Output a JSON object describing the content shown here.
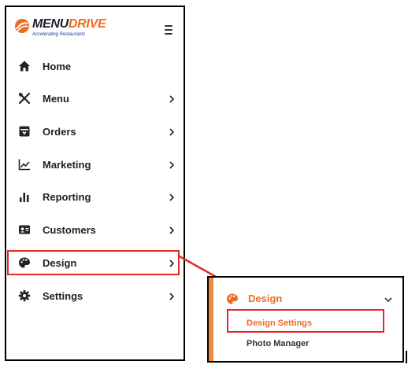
{
  "brand": {
    "name_part1": "MENU",
    "name_part2": "DRIVE",
    "tagline": "Accelerating Restaurants"
  },
  "sidebar": {
    "items": [
      {
        "label": "Home",
        "icon": "home-icon",
        "has_chevron": false
      },
      {
        "label": "Menu",
        "icon": "utensils-icon",
        "has_chevron": true
      },
      {
        "label": "Orders",
        "icon": "orders-box-icon",
        "has_chevron": true
      },
      {
        "label": "Marketing",
        "icon": "line-chart-icon",
        "has_chevron": true
      },
      {
        "label": "Reporting",
        "icon": "bar-chart-icon",
        "has_chevron": true
      },
      {
        "label": "Customers",
        "icon": "contact-card-icon",
        "has_chevron": true
      },
      {
        "label": "Design",
        "icon": "palette-icon",
        "has_chevron": true
      },
      {
        "label": "Settings",
        "icon": "gear-icon",
        "has_chevron": true
      }
    ]
  },
  "submenu": {
    "title": "Design",
    "items": [
      {
        "label": "Design Settings",
        "active": true
      },
      {
        "label": "Photo Manager",
        "active": false
      }
    ]
  },
  "colors": {
    "accent": "#f06b22",
    "highlight": "#e02a2a",
    "text": "#222222",
    "submenu_bar": "#f08a3c"
  }
}
